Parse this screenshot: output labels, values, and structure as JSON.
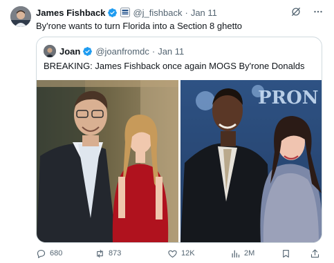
{
  "tweet": {
    "author_name": "James Fishback",
    "handle": "@j_fishback",
    "separator": "·",
    "date": "Jan 11",
    "text": "By'rone wants to turn Florida into a Section 8 ghetto"
  },
  "quote": {
    "author_name": "Joan",
    "handle": "@joanfromdc",
    "separator": "·",
    "date": "Jan 11",
    "text": "BREAKING: James Fishback once again MOGS By'rone Donalds",
    "photo_right_sign": "PRON"
  },
  "actions": {
    "replies": "680",
    "reposts": "873",
    "likes": "12K",
    "views": "2M"
  },
  "icons": {
    "verified": "verified-badge-icon",
    "affiliation": "affiliation-badge-icon",
    "grok": "grok-icon",
    "more": "more-icon",
    "reply": "reply-icon",
    "repost": "repost-icon",
    "like": "heart-icon",
    "views": "views-icon",
    "bookmark": "bookmark-icon",
    "share": "share-icon"
  },
  "colors": {
    "verified": "#1d9bf0",
    "text": "#0f1419",
    "muted": "#536471",
    "border": "#cfd9de"
  }
}
